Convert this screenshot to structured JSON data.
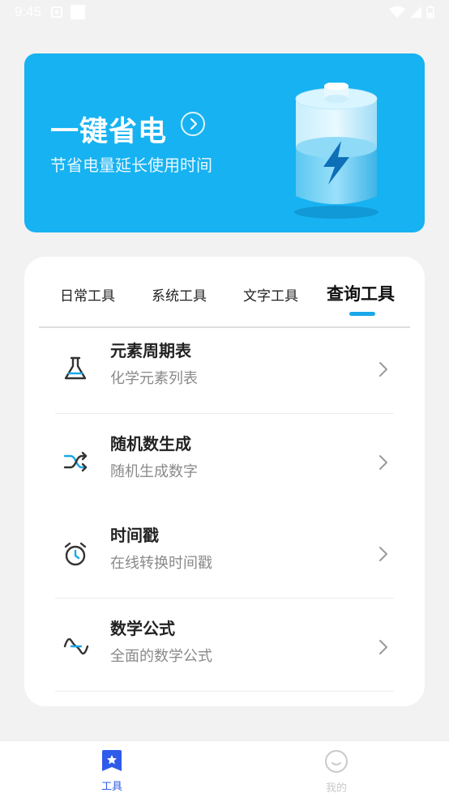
{
  "status_bar": {
    "time": "9:45"
  },
  "banner": {
    "title": "一键省电",
    "subtitle": "节省电量延长使用时间",
    "bg_color": "#17b2f1"
  },
  "tabs": [
    {
      "label": "日常工具",
      "active": false
    },
    {
      "label": "系统工具",
      "active": false
    },
    {
      "label": "文字工具",
      "active": false
    },
    {
      "label": "查询工具",
      "active": true
    }
  ],
  "tools": [
    {
      "title": "元素周期表",
      "desc": "化学元素列表",
      "icon": "flask-icon"
    },
    {
      "title": "随机数生成",
      "desc": "随机生成数字",
      "icon": "shuffle-icon"
    },
    {
      "title": "时间戳",
      "desc": "在线转换时间戳",
      "icon": "alarm-clock-icon"
    },
    {
      "title": "数学公式",
      "desc": "全面的数学公式",
      "icon": "sine-wave-icon"
    }
  ],
  "bottom_nav": [
    {
      "label": "工具",
      "icon": "star-bookmark-icon",
      "active": true,
      "color": "#2f5bea"
    },
    {
      "label": "我的",
      "icon": "smiley-icon",
      "active": false,
      "color": "#c9c9c9"
    }
  ]
}
